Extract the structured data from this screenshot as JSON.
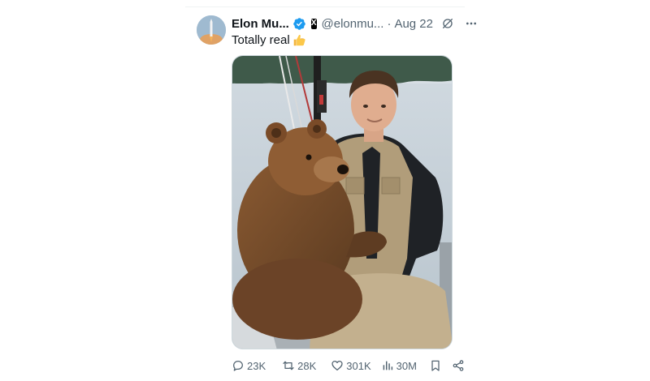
{
  "tweet": {
    "author_name": "Elon Mu...",
    "handle": "@elonmu...",
    "separator": "·",
    "date": "Aug 22",
    "text": "Totally real",
    "badge_letter": "X",
    "icons": {
      "verified": "verified-badge-icon",
      "affiliate": "x-affiliate-badge-icon",
      "grok": "grok-icon",
      "more": "more-options-icon",
      "emoji": "thumbs-up-emoji-icon"
    }
  },
  "media": {
    "description_icon": "photo-bear-and-man-on-boat"
  },
  "actions": {
    "replies": "23K",
    "reposts": "28K",
    "likes": "301K",
    "views": "30M"
  },
  "colors": {
    "verified_blue": "#1d9bf0",
    "secondary_text": "#536471",
    "primary_text": "#0f1419"
  }
}
